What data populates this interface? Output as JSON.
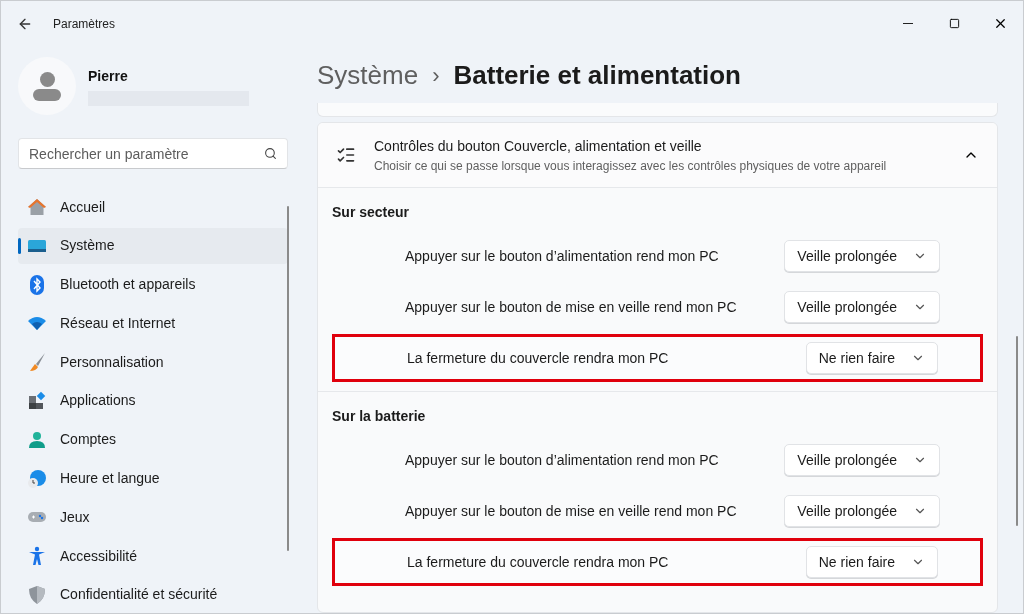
{
  "window": {
    "title": "Paramètres"
  },
  "user": {
    "name": "Pierre"
  },
  "search": {
    "placeholder": "Rechercher un paramètre"
  },
  "sidebar": {
    "items": [
      {
        "label": "Accueil",
        "selected": false
      },
      {
        "label": "Système",
        "selected": true
      },
      {
        "label": "Bluetooth et appareils",
        "selected": false
      },
      {
        "label": "Réseau et Internet",
        "selected": false
      },
      {
        "label": "Personnalisation",
        "selected": false
      },
      {
        "label": "Applications",
        "selected": false
      },
      {
        "label": "Comptes",
        "selected": false
      },
      {
        "label": "Heure et langue",
        "selected": false
      },
      {
        "label": "Jeux",
        "selected": false
      },
      {
        "label": "Accessibilité",
        "selected": false
      },
      {
        "label": "Confidentialité et sécurité",
        "selected": false
      }
    ]
  },
  "breadcrumb": {
    "parent": "Système",
    "separator": "›",
    "current": "Batterie et alimentation"
  },
  "card": {
    "title": "Contrôles du bouton Couvercle, alimentation et veille",
    "subtitle": "Choisir ce qui se passe lorsque vous interagissez avec les contrôles physiques de votre appareil",
    "expanded": true,
    "sections": [
      {
        "label": "Sur secteur",
        "rows": [
          {
            "label": "Appuyer sur le bouton d’alimentation rend mon PC",
            "value": "Veille prolongée",
            "highlighted": false
          },
          {
            "label": "Appuyer sur le bouton de mise en veille rend mon PC",
            "value": "Veille prolongée",
            "highlighted": false
          },
          {
            "label": "La fermeture du couvercle rendra mon PC",
            "value": "Ne rien faire",
            "highlighted": true
          }
        ]
      },
      {
        "label": "Sur la batterie",
        "rows": [
          {
            "label": "Appuyer sur le bouton d’alimentation rend mon PC",
            "value": "Veille prolongée",
            "highlighted": false
          },
          {
            "label": "Appuyer sur le bouton de mise en veille rend mon PC",
            "value": "Veille prolongée",
            "highlighted": false
          },
          {
            "label": "La fermeture du couvercle rendra mon PC",
            "value": "Ne rien faire",
            "highlighted": true
          }
        ]
      }
    ]
  }
}
